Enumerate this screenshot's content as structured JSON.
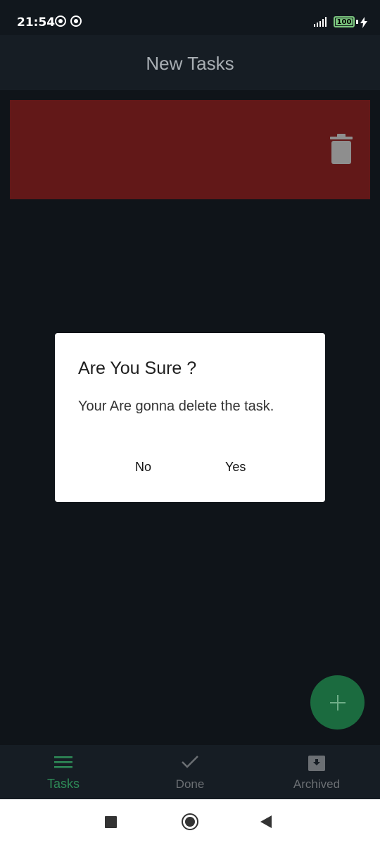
{
  "status_bar": {
    "time": "21:54",
    "battery": "100"
  },
  "app_bar": {
    "title": "New Tasks"
  },
  "dialog": {
    "title": "Are You Sure ?",
    "message": "Your Are gonna delete the task.",
    "no_label": "No",
    "yes_label": "Yes"
  },
  "bottom_nav": {
    "items": [
      {
        "label": "Tasks",
        "icon": "menu-icon",
        "active": true
      },
      {
        "label": "Done",
        "icon": "check-icon",
        "active": false
      },
      {
        "label": "Archived",
        "icon": "archive-icon",
        "active": false
      }
    ]
  },
  "colors": {
    "accent": "#2e8b57",
    "delete_background": "#621818",
    "background": "#0f1419"
  }
}
